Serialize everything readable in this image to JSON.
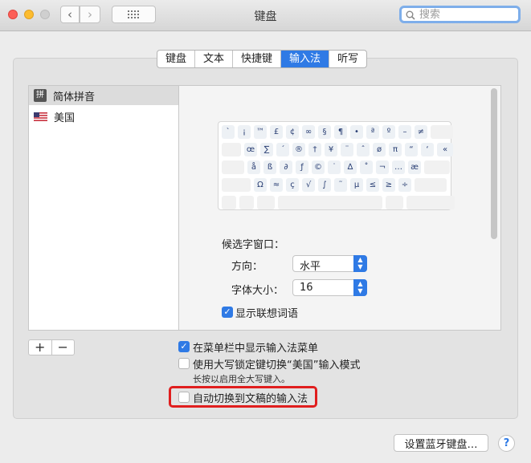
{
  "window": {
    "title": "键盘"
  },
  "search": {
    "placeholder": "搜索"
  },
  "tabs": [
    {
      "label": "键盘",
      "active": false
    },
    {
      "label": "文本",
      "active": false
    },
    {
      "label": "快捷键",
      "active": false
    },
    {
      "label": "输入法",
      "active": true
    },
    {
      "label": "听写",
      "active": false
    }
  ],
  "sources": [
    {
      "name": "简体拼音",
      "icon": "pinyin-icon",
      "icon_char": "拼",
      "selected": true
    },
    {
      "name": "美国",
      "icon": "us-flag-icon",
      "selected": false
    }
  ],
  "keyboard_rows": [
    [
      "`",
      "¡",
      "™",
      "£",
      "¢",
      "∞",
      "§",
      "¶",
      "•",
      "ª",
      "º",
      "–",
      "≠",
      ""
    ],
    [
      "",
      "œ",
      "∑",
      "´",
      "®",
      "†",
      "¥",
      "¨",
      "ˆ",
      "ø",
      "π",
      "“",
      "‘",
      "«"
    ],
    [
      "",
      "å",
      "ß",
      "∂",
      "ƒ",
      "©",
      "˙",
      "∆",
      "˚",
      "¬",
      "…",
      "æ",
      ""
    ],
    [
      "",
      "Ω",
      "≈",
      "ç",
      "√",
      "∫",
      "˜",
      "µ",
      "≤",
      "≥",
      "÷",
      ""
    ],
    [
      "",
      "",
      "",
      "",
      "",
      ""
    ]
  ],
  "candidate": {
    "heading": "候选字窗口：",
    "orientation_label": "方向：",
    "orientation_value": "水平",
    "fontsize_label": "字体大小：",
    "fontsize_value": "16",
    "predictive_label": "显示联想词语",
    "predictive_checked": true
  },
  "plus_minus": {
    "plus": "+",
    "minus": "−"
  },
  "options": {
    "show_menu_label": "在菜单栏中显示输入法菜单",
    "show_menu_checked": true,
    "capslock_label": "使用大写锁定键切换“美国”输入模式",
    "capslock_checked": false,
    "capslock_hint": "长按以启用全大写键入。",
    "auto_switch_label": "自动切换到文稿的输入法",
    "auto_switch_checked": false
  },
  "bottom": {
    "bluetooth_button": "设置蓝牙键盘…",
    "help": "?"
  },
  "colors": {
    "accent": "#2f7ae5",
    "highlight": "#e01e1e"
  }
}
